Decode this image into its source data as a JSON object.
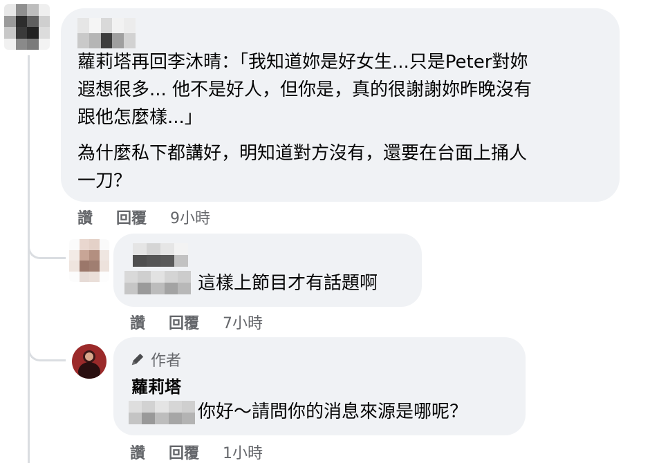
{
  "comments": [
    {
      "text_line1": "蘿莉塔再回李沐晴：「我知道妳是好女生...只是Peter對妳",
      "text_line2": "遐想很多... 他不是好人，但你是，真的很謝謝妳昨晚沒有",
      "text_line3": "跟他怎麼樣...」",
      "text_line4": "為什麼私下都講好，明知道對方沒有，還要在台面上捅人",
      "text_line5": "一刀？",
      "like": "讚",
      "reply": "回覆",
      "time": "9小時"
    },
    {
      "text": "這樣上節目才有話題啊",
      "like": "讚",
      "reply": "回覆",
      "time": "7小時"
    },
    {
      "badge": "作者",
      "author": "蘿莉塔",
      "text": "你好～請問你的消息來源是哪呢？",
      "like": "讚",
      "reply": "回覆",
      "time": "1小時"
    }
  ],
  "icons": {
    "author_badge": "pencil-icon"
  },
  "colors": {
    "bubble": "#f0f2f5",
    "meta": "#65676b",
    "text": "#050505",
    "line": "#dadde1"
  }
}
